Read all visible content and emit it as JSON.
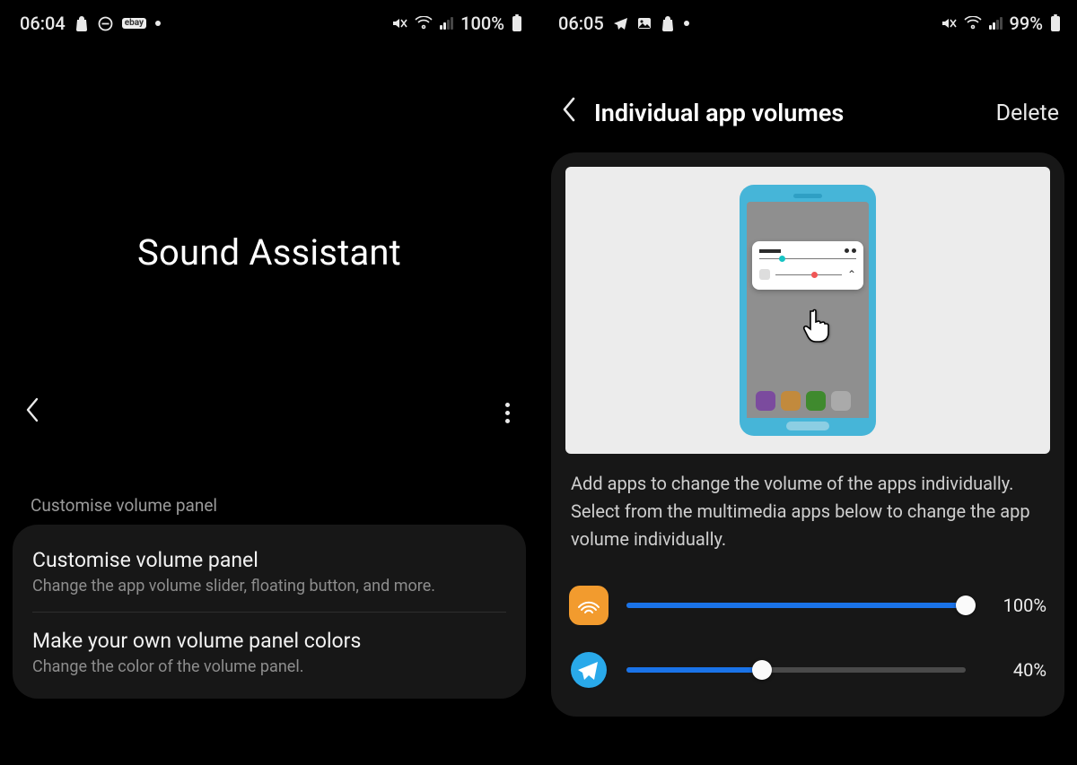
{
  "left": {
    "statusbar": {
      "time": "06:04",
      "battery": "100%",
      "ebay": "ebay"
    },
    "hero": "Sound Assistant",
    "section_label": "Customise volume panel",
    "items": [
      {
        "title": "Customise volume panel",
        "sub": "Change the app volume slider, floating button, and more."
      },
      {
        "title": "Make your own volume panel colors",
        "sub": "Change the color of the volume panel."
      }
    ]
  },
  "right": {
    "statusbar": {
      "time": "06:05",
      "battery": "99%"
    },
    "header": {
      "title": "Individual app volumes",
      "action": "Delete"
    },
    "description": "Add apps to change the volume of the apps individually. Select from the multimedia apps below to change the app volume individually.",
    "apps": [
      {
        "name": "audible",
        "pct": 100,
        "pct_label": "100%"
      },
      {
        "name": "telegram",
        "pct": 40,
        "pct_label": "40%"
      }
    ]
  }
}
